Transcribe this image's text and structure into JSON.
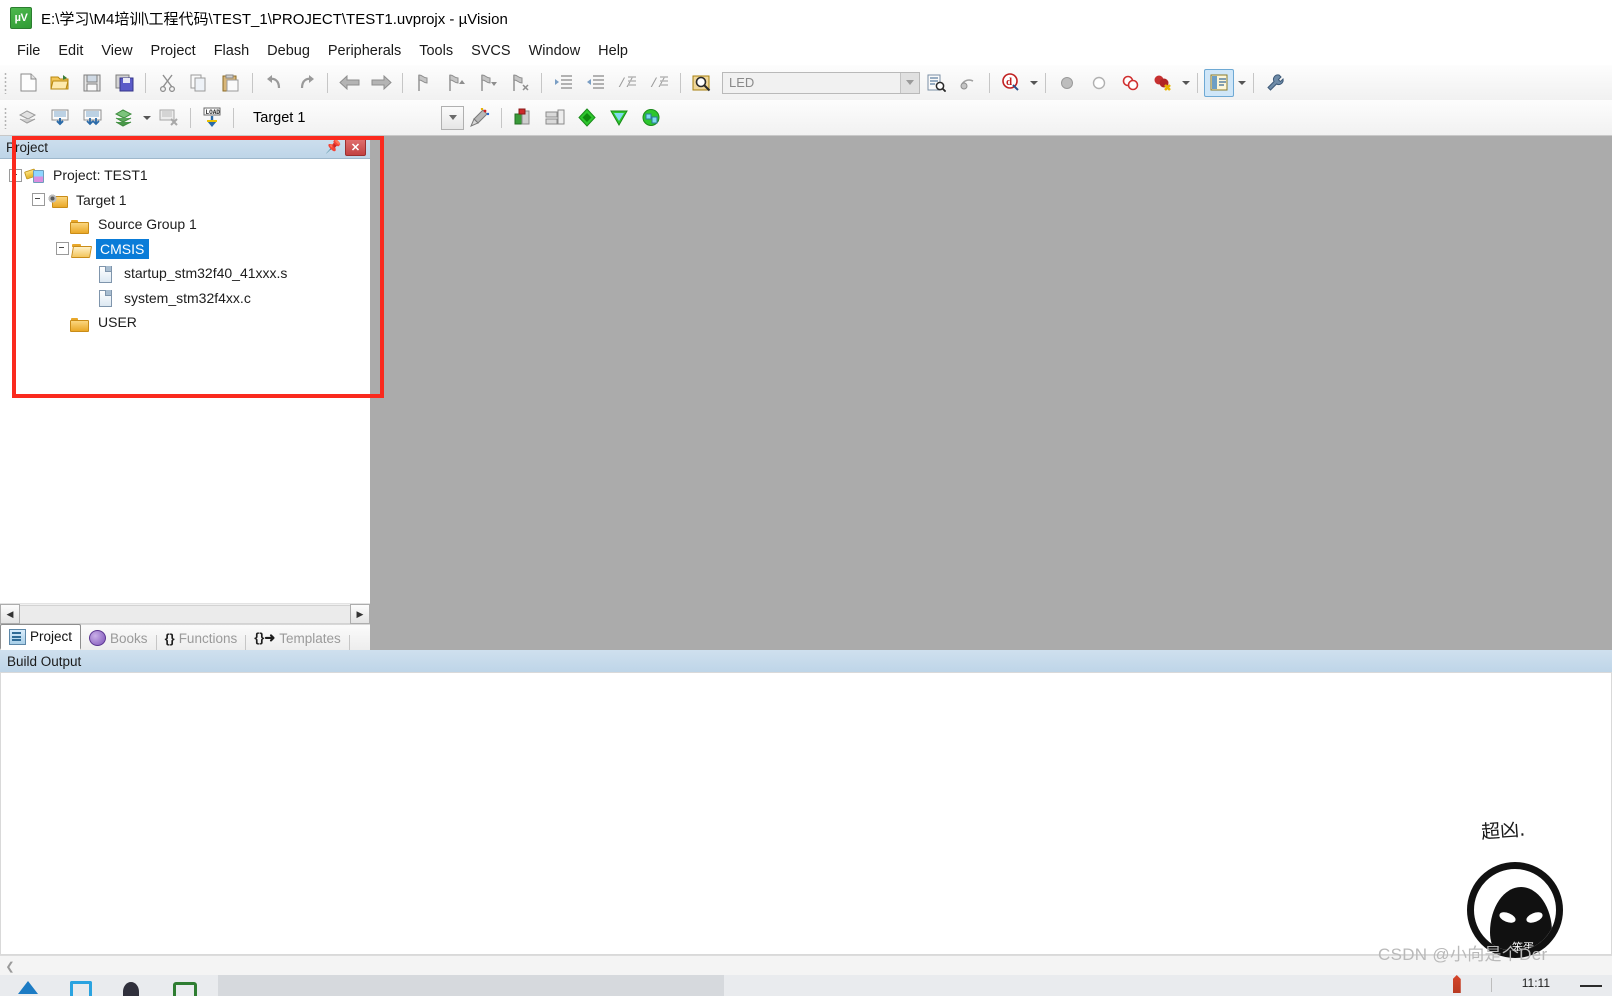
{
  "window": {
    "title": "E:\\学习\\M4培训\\工程代码\\TEST_1\\PROJECT\\TEST1.uvprojx - µVision",
    "app_icon": "uvision-icon"
  },
  "menubar": {
    "items": [
      {
        "label": "File",
        "name": "menu-file"
      },
      {
        "label": "Edit",
        "name": "menu-edit"
      },
      {
        "label": "View",
        "name": "menu-view"
      },
      {
        "label": "Project",
        "name": "menu-project"
      },
      {
        "label": "Flash",
        "name": "menu-flash"
      },
      {
        "label": "Debug",
        "name": "menu-debug"
      },
      {
        "label": "Peripherals",
        "name": "menu-peripherals"
      },
      {
        "label": "Tools",
        "name": "menu-tools"
      },
      {
        "label": "SVCS",
        "name": "menu-svcs"
      },
      {
        "label": "Window",
        "name": "menu-window"
      },
      {
        "label": "Help",
        "name": "menu-help"
      }
    ]
  },
  "toolbar_file": {
    "buttons": [
      {
        "icon": "new-file-icon",
        "glyph": "⬜"
      },
      {
        "icon": "open-file-icon",
        "glyph": "📂"
      },
      {
        "icon": "save-icon",
        "glyph": "💾"
      },
      {
        "icon": "save-all-icon",
        "glyph": "🖫"
      },
      {
        "icon": "cut-icon",
        "glyph": "✂"
      },
      {
        "icon": "copy-icon",
        "glyph": "⧉"
      },
      {
        "icon": "paste-icon",
        "glyph": "📋"
      },
      {
        "icon": "undo-icon",
        "glyph": "↶"
      },
      {
        "icon": "redo-icon",
        "glyph": "↷"
      },
      {
        "icon": "navigate-backward-icon",
        "glyph": "←"
      },
      {
        "icon": "navigate-forward-icon",
        "glyph": "→"
      },
      {
        "icon": "bookmark-toggle-icon",
        "glyph": "⚑"
      },
      {
        "icon": "bookmark-prev-icon",
        "glyph": "⚑"
      },
      {
        "icon": "bookmark-next-icon",
        "glyph": "⚑"
      },
      {
        "icon": "bookmark-clear-icon",
        "glyph": "⚑"
      },
      {
        "icon": "indent-icon",
        "glyph": "≡"
      },
      {
        "icon": "outdent-icon",
        "glyph": "≡"
      },
      {
        "icon": "comment-icon",
        "glyph": "//"
      },
      {
        "icon": "uncomment-icon",
        "glyph": "//"
      },
      {
        "icon": "find-in-files-icon",
        "glyph": "🔍"
      }
    ],
    "find": {
      "value": "LED",
      "placeholder": "LED",
      "dropdown_icon": "chevron-down-icon"
    },
    "after_find": [
      {
        "icon": "find-in-files-button-icon",
        "glyph": "🗎"
      },
      {
        "icon": "incremental-find-icon",
        "glyph": "🔎"
      }
    ],
    "debug_group": [
      {
        "icon": "start-debug-icon",
        "glyph": "d"
      },
      {
        "icon": "insert-breakpoint-icon",
        "glyph": "⬤"
      },
      {
        "icon": "disable-breakpoint-icon",
        "glyph": "◯"
      },
      {
        "icon": "disable-all-breakpoints-icon",
        "glyph": "⚭"
      },
      {
        "icon": "kill-all-breakpoints-icon",
        "glyph": "⬤"
      }
    ],
    "right_group": [
      {
        "icon": "window-layout-icon",
        "glyph": "▤",
        "active": true
      },
      {
        "icon": "configuration-wizard-icon",
        "glyph": "🔧"
      }
    ]
  },
  "toolbar_build": {
    "buttons": [
      {
        "icon": "translate-file-icon",
        "glyph": "⬛"
      },
      {
        "icon": "build-target-icon",
        "glyph": "⬛"
      },
      {
        "icon": "rebuild-all-icon",
        "glyph": "⬛"
      },
      {
        "icon": "batch-build-icon",
        "glyph": "⬛"
      },
      {
        "icon": "stop-build-icon",
        "glyph": "⬛"
      },
      {
        "icon": "download-icon",
        "glyph": "LOAD"
      }
    ],
    "target_select": {
      "value": "Target 1",
      "dropdown_icon": "chevron-down-icon"
    },
    "after_target": [
      {
        "icon": "target-options-icon",
        "glyph": "🪄"
      },
      {
        "icon": "manage-project-items-icon",
        "glyph": "▣"
      },
      {
        "icon": "manage-multi-project-icon",
        "glyph": "❐"
      },
      {
        "icon": "manage-runtime-env-icon",
        "glyph": "◆"
      },
      {
        "icon": "pack-installer-icon",
        "glyph": "◆"
      },
      {
        "icon": "software-packs-icon",
        "glyph": "◆"
      }
    ]
  },
  "project_panel": {
    "title": "Project",
    "pin_icon": "pin-icon",
    "close_icon": "close-icon",
    "tree": [
      {
        "label": "Project: TEST1",
        "level": 0,
        "icon": "project-icon",
        "expander": "minus",
        "selected": false
      },
      {
        "label": "Target 1",
        "level": 1,
        "icon": "target-icon",
        "expander": "minus",
        "selected": false
      },
      {
        "label": "Source Group 1",
        "level": 2,
        "icon": "folder-icon",
        "expander": "none",
        "selected": false
      },
      {
        "label": "CMSIS",
        "level": 2,
        "icon": "folder-open-icon",
        "expander": "minus",
        "selected": true
      },
      {
        "label": "startup_stm32f40_41xxx.s",
        "level": 3,
        "icon": "file-icon",
        "expander": "none",
        "selected": false
      },
      {
        "label": "system_stm32f4xx.c",
        "level": 3,
        "icon": "file-icon",
        "expander": "none",
        "selected": false
      },
      {
        "label": "USER",
        "level": 2,
        "icon": "folder-icon",
        "expander": "none",
        "selected": false
      }
    ],
    "scroll_left_icon": "scroll-left-arrow-icon",
    "scroll_right_icon": "scroll-right-arrow-icon",
    "tabs": [
      {
        "label": "Project",
        "icon": "project-tab-icon",
        "active": true
      },
      {
        "label": "Books",
        "icon": "books-tab-icon",
        "active": false
      },
      {
        "label": "Functions",
        "icon": "functions-tab-icon",
        "glyph": "{}",
        "active": false
      },
      {
        "label": "Templates",
        "icon": "templates-tab-icon",
        "glyph": "{}➜",
        "active": false
      }
    ]
  },
  "build_output": {
    "title": "Build Output",
    "content": "",
    "scroll_back_icon": "scroll-back-icon"
  },
  "taskbar": {
    "icons": [
      {
        "name": "edge-icon"
      },
      {
        "name": "store-icon"
      },
      {
        "name": "mail-icon"
      },
      {
        "name": "wechat-icon"
      }
    ],
    "clock": "11:11",
    "pen_icon": "pen-icon",
    "show-desktop-icon": "show-desktop-icon"
  },
  "watermark": {
    "text": "CSDN @小向是个Der",
    "avatar_caption": "超凶.",
    "avatar_name": "avatar-icon",
    "avatar_inner_text": "笨蛋"
  },
  "annotation": {
    "name": "red-highlight-rectangle",
    "color": "#fa2a1e"
  },
  "colors": {
    "mdi_background": "#ababab",
    "panel_header": "#bed5e8",
    "tree_selection": "#0a7cd8",
    "annotation_red": "#fa2a1e"
  }
}
